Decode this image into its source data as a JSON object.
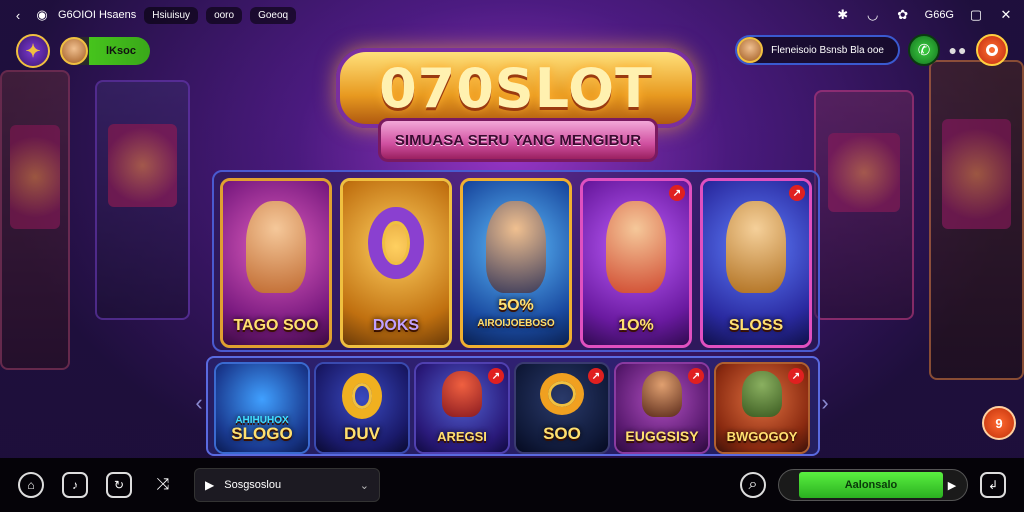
{
  "status_bar": {
    "app_title": "G6OIOI Hsaens",
    "pill_1": "Hsiuisuy",
    "pill_2": "ooro",
    "pill_3": "Goeoq",
    "right_text": "G66G"
  },
  "top_left": {
    "user_name": "lKsoc"
  },
  "top_right": {
    "promo_text": "Fleneisoio Bsnsb Bla ooe"
  },
  "logo": {
    "title": "070SLOT",
    "subtitle": "SIMUASA SERU YANG MENGIBUR"
  },
  "games_row_1": [
    {
      "label": "TAGO SOO",
      "badge": ""
    },
    {
      "label": "DOKS",
      "badge": ""
    },
    {
      "label": "5O%",
      "sublabel": "AIROIJOEBOSO",
      "badge": ""
    },
    {
      "label": "1O%",
      "badge": "↗"
    },
    {
      "label": "SLOSS",
      "badge": "↗"
    }
  ],
  "games_row_2": [
    {
      "label": "SLOGO",
      "sublabel": "AHIHUHOX",
      "badge": ""
    },
    {
      "label": "DUV",
      "badge": ""
    },
    {
      "label": "AREGSI",
      "badge": "↗"
    },
    {
      "label": "SOO",
      "badge": "↗"
    },
    {
      "label": "EUGGSISY",
      "badge": "↗"
    },
    {
      "label": "BWGOGOY",
      "badge": "↗"
    }
  ],
  "side_button": {
    "label": "9"
  },
  "bottom_bar": {
    "search_text": "Sosgsoslou",
    "cta_label": "Aalonsalo"
  },
  "colors": {
    "accent_green": "#3ad040",
    "accent_orange": "#ff7030",
    "logo_gold": "#e89a20",
    "logo_border": "#7a2fa0"
  }
}
